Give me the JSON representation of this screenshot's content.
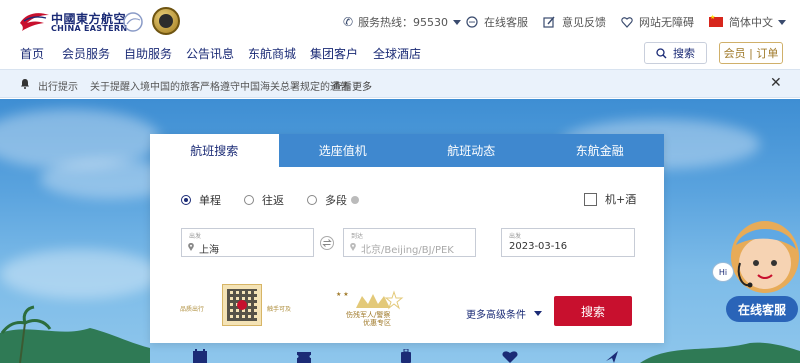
{
  "brand": {
    "name_cn": "中國東方航空",
    "name_en": "CHINA EASTERN"
  },
  "toplinks": {
    "hotline": "服务热线：95530",
    "online_service": "在线客服",
    "feedback": "意见反馈",
    "accessibility": "网站无障碍",
    "language": "简体中文"
  },
  "nav": {
    "items": [
      "首页",
      "会员服务",
      "自助服务",
      "公告讯息",
      "东航商城",
      "集团客户",
      "全球酒店"
    ],
    "search": "搜索",
    "member": "会员 | 订单"
  },
  "notice": {
    "label": "出行提示",
    "text": "关于提醒入境中国的旅客严格遵守中国海关总署规定的通告",
    "more": "查看更多",
    "close": "✕"
  },
  "booking": {
    "tabs": [
      "航班搜索",
      "选座值机",
      "航班动态",
      "东航金融"
    ],
    "trip_types": [
      "单程",
      "往返",
      "多段"
    ],
    "selected_trip": "单程",
    "hotel_option": "机+酒",
    "from_label": "出发",
    "from_value": "上海",
    "to_label": "到达",
    "to_placeholder": "北京/Beijing/BJ/PEK",
    "date_label": "出发",
    "date_value": "2023-03-16",
    "advanced": "更多高级条件",
    "search": "搜索"
  },
  "promo": {
    "qr_left": "品质出行",
    "qr_right": "触手可及",
    "title_line1": "伤残军人/警察",
    "title_line2": "优惠专区"
  },
  "mascot": {
    "hi": "Hi",
    "button": "在线客服"
  },
  "colors": {
    "brand_navy": "#1b2b76",
    "tab_blue": "#3f88cf",
    "submit_red": "#c8102e",
    "gold": "#a07a2a"
  }
}
